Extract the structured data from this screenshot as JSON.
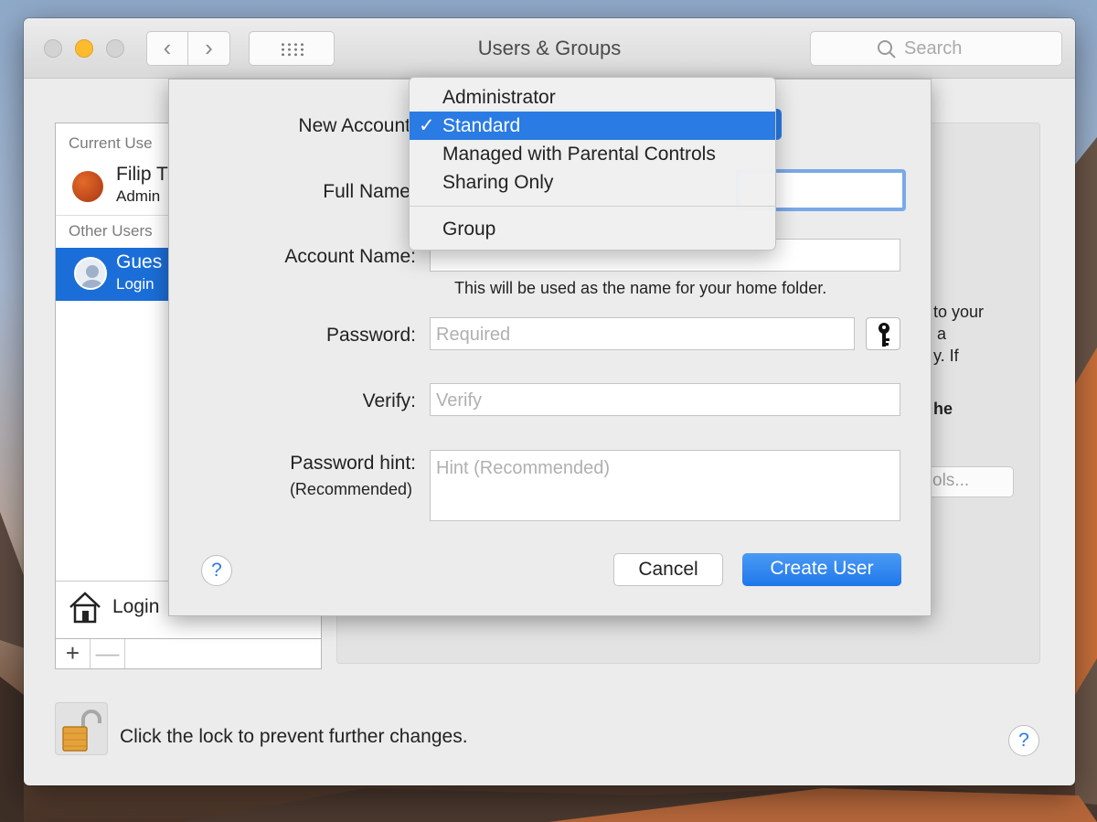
{
  "window": {
    "title": "Users & Groups",
    "search_placeholder": "Search",
    "nav_back": "‹",
    "nav_forward": "›"
  },
  "sidebar": {
    "current_users_header": "Current Use",
    "current_user": {
      "name": "Filip T",
      "role": "Admin"
    },
    "other_users_header": "Other Users",
    "other_user": {
      "name": "Gues",
      "role": "Login"
    },
    "login_options_label": "Login",
    "add_label": "+",
    "remove_label": "—"
  },
  "right_panel": {
    "text_lines": [
      "to your",
      "a",
      "y. If",
      "he"
    ],
    "button_label": "ols..."
  },
  "footer": {
    "lock_text": "Click the lock to prevent further changes.",
    "help_label": "?"
  },
  "sheet": {
    "new_account_label": "New Account",
    "full_name_label": "Full Name",
    "account_name_label": "Account Name:",
    "account_name_hint": "This will be used as the name for your home folder.",
    "password_label": "Password:",
    "password_placeholder": "Required",
    "verify_label": "Verify:",
    "verify_placeholder": "Verify",
    "hint_label": "Password hint:",
    "hint_sublabel": "(Recommended)",
    "hint_placeholder": "Hint (Recommended)",
    "help_label": "?",
    "cancel_label": "Cancel",
    "create_label": "Create User"
  },
  "dropdown": {
    "check_mark": "✓",
    "items": [
      "Administrator",
      "Standard",
      "Managed with Parental Controls",
      "Sharing Only"
    ],
    "selected_item": "Standard",
    "group_item": "Group"
  },
  "colors": {
    "accent": "#2a7be4",
    "selection": "#1b6ed7",
    "minimize": "#fdbc2e"
  }
}
